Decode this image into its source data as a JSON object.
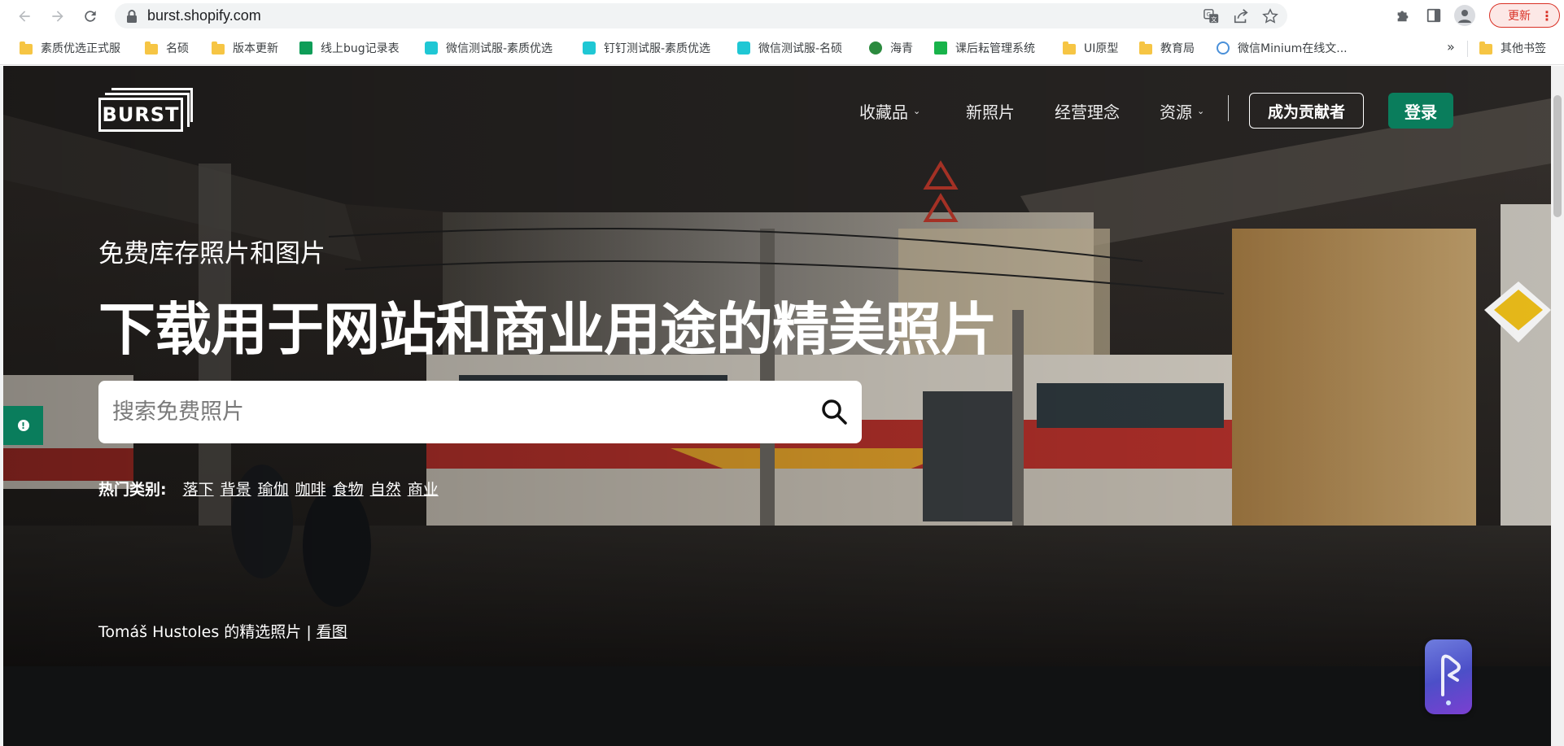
{
  "browser": {
    "url": "burst.shopify.com",
    "update_label": "更新",
    "menu_dots": "⋮",
    "more_bookmarks": "»",
    "bookmarks": [
      {
        "label": "素质优选正式服",
        "icon": "folder-icon"
      },
      {
        "label": "名硕",
        "icon": "folder-icon"
      },
      {
        "label": "版本更新",
        "icon": "folder-icon"
      },
      {
        "label": "线上bug记录表",
        "icon": "sheet-icon"
      },
      {
        "label": "微信测试服-素质优选",
        "icon": "app-icon"
      },
      {
        "label": "钉钉测试服-素质优选",
        "icon": "app-icon"
      },
      {
        "label": "微信测试服-名硕",
        "icon": "app-icon"
      },
      {
        "label": "海青",
        "icon": "site-icon"
      },
      {
        "label": "课后耘管理系统",
        "icon": "app-icon"
      },
      {
        "label": "UI原型",
        "icon": "folder-icon"
      },
      {
        "label": "教育局",
        "icon": "folder-icon"
      },
      {
        "label": "微信Minium在线文...",
        "icon": "site-icon"
      },
      {
        "label": "其他书签",
        "icon": "folder-icon"
      }
    ]
  },
  "site": {
    "logo_text": "BURST",
    "nav": [
      {
        "label": "收藏品",
        "has_caret": true
      },
      {
        "label": "新照片",
        "has_caret": false
      },
      {
        "label": "经营理念",
        "has_caret": false
      },
      {
        "label": "资源",
        "has_caret": true
      }
    ],
    "caret": "⌄",
    "contributor_label": "成为贡献者",
    "login_label": "登录"
  },
  "hero": {
    "subtitle": "免费库存照片和图片",
    "headline": "下载用于网站和商业用途的精美照片",
    "search_placeholder": "搜索免费照片",
    "popular_label": "热门类别:",
    "categories": [
      "落下",
      "背景",
      "瑜伽",
      "咖啡",
      "食物",
      "自然",
      "商业"
    ],
    "credit_text": "Tomáš Hustoles 的精选照片 |",
    "credit_link": "看图"
  },
  "colors": {
    "brand_green": "#0a7d5c",
    "update_red": "#d93025"
  }
}
